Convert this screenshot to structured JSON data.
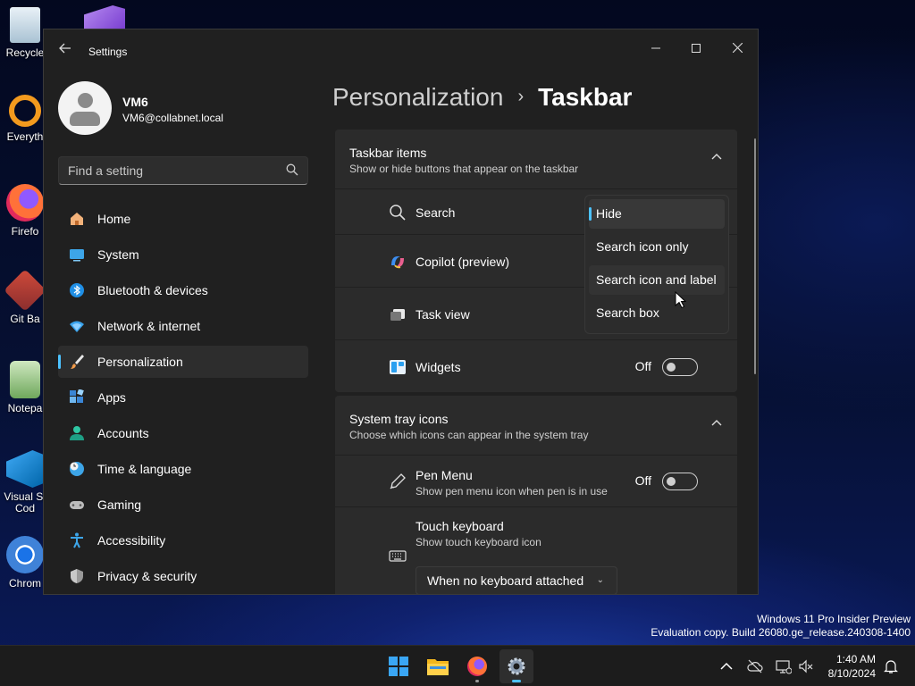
{
  "desktop": {
    "icons": [
      {
        "label": "Recycle",
        "icon": "recycle-bin-icon"
      },
      {
        "label": "Everyth",
        "icon": "everything-icon"
      },
      {
        "label": "Firefo",
        "icon": "firefox-icon"
      },
      {
        "label": "Git Ba",
        "icon": "git-bash-icon"
      },
      {
        "label": "Notepa",
        "icon": "notepad-icon"
      },
      {
        "label": "Visual St\nCod",
        "icon": "vscode-icon"
      },
      {
        "label": "Chrom",
        "icon": "chrome-icon"
      }
    ],
    "watermark": {
      "line1": "Windows 11 Pro Insider Preview",
      "line2": "Evaluation copy. Build 26080.ge_release.240308-1400"
    }
  },
  "window": {
    "title": "Settings",
    "controls": {
      "minimize": "─",
      "maximize": "☐",
      "close": "✕"
    }
  },
  "user": {
    "name": "VM6",
    "email": "VM6@collabnet.local"
  },
  "search": {
    "placeholder": "Find a setting"
  },
  "sidebar": {
    "items": [
      {
        "label": "Home",
        "icon": "home-icon"
      },
      {
        "label": "System",
        "icon": "system-icon"
      },
      {
        "label": "Bluetooth & devices",
        "icon": "bluetooth-icon"
      },
      {
        "label": "Network & internet",
        "icon": "network-icon"
      },
      {
        "label": "Personalization",
        "icon": "brush-icon",
        "active": true
      },
      {
        "label": "Apps",
        "icon": "apps-icon"
      },
      {
        "label": "Accounts",
        "icon": "accounts-icon"
      },
      {
        "label": "Time & language",
        "icon": "clock-globe-icon"
      },
      {
        "label": "Gaming",
        "icon": "gamepad-icon"
      },
      {
        "label": "Accessibility",
        "icon": "accessibility-icon"
      },
      {
        "label": "Privacy & security",
        "icon": "shield-icon"
      }
    ]
  },
  "breadcrumb": {
    "parent": "Personalization",
    "separator": "›",
    "current": "Taskbar"
  },
  "taskbar_items": {
    "title": "Taskbar items",
    "subtitle": "Show or hide buttons that appear on the taskbar",
    "rows": [
      {
        "label": "Search",
        "icon": "search-icon"
      },
      {
        "label": "Copilot (preview)",
        "icon": "copilot-icon"
      },
      {
        "label": "Task view",
        "icon": "task-view-icon"
      },
      {
        "label": "Widgets",
        "icon": "widgets-icon",
        "state": "Off"
      }
    ]
  },
  "search_dropdown": {
    "options": [
      "Hide",
      "Search icon only",
      "Search icon and label",
      "Search box"
    ],
    "selected": "Hide",
    "hovered": "Search icon and label"
  },
  "system_tray": {
    "title": "System tray icons",
    "subtitle": "Choose which icons can appear in the system tray",
    "rows": [
      {
        "label": "Pen Menu",
        "sublabel": "Show pen menu icon when pen is in use",
        "icon": "pen-icon",
        "state": "Off"
      },
      {
        "label": "Touch keyboard",
        "sublabel": "Show touch keyboard icon",
        "icon": "keyboard-icon",
        "value": "When no keyboard attached"
      }
    ]
  },
  "taskbar": {
    "apps": [
      "windows-start-icon",
      "file-explorer-icon",
      "firefox-icon",
      "settings-gear-icon"
    ],
    "tray": [
      "chevron-up-icon",
      "cloud-off-icon",
      "network-icon",
      "volume-muted-icon",
      "notification-bell-icon"
    ],
    "time": "1:40 AM",
    "date": "8/10/2024"
  },
  "colors": {
    "accent": "#4cc2ff",
    "window_bg": "#202020",
    "card_bg": "#2b2b2b"
  }
}
